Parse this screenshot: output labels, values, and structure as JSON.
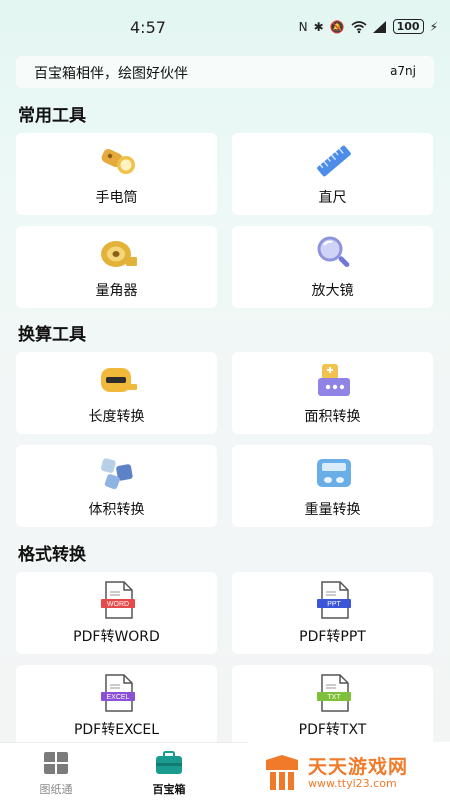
{
  "status_bar": {
    "time": "4:57",
    "battery": "100"
  },
  "banner": {
    "slogan": "百宝箱相伴，绘图好伙伴",
    "code": "a7nj"
  },
  "sections": {
    "common": {
      "title": "常用工具",
      "items": [
        "手电筒",
        "直尺",
        "量角器",
        "放大镜"
      ]
    },
    "convert": {
      "title": "换算工具",
      "items": [
        "长度转换",
        "面积转换",
        "体积转换",
        "重量转换"
      ]
    },
    "format": {
      "title": "格式转换",
      "items": [
        "PDF转WORD",
        "PDF转PPT",
        "PDF转EXCEL",
        "PDF转TXT"
      ],
      "badges": [
        "WORD",
        "PPT",
        "EXCEL",
        "TXT"
      ]
    }
  },
  "tabs": [
    {
      "label": "图纸通",
      "active": false
    },
    {
      "label": "百宝箱",
      "active": true
    }
  ],
  "watermark": {
    "brand": "天天游戏网",
    "url": "www.ttyl23.com"
  },
  "colors": {
    "accent": "#1a9b8f",
    "word": "#e74a4a",
    "ppt": "#3b55d9",
    "excel": "#8b4fd8",
    "txt": "#7fc03a"
  }
}
